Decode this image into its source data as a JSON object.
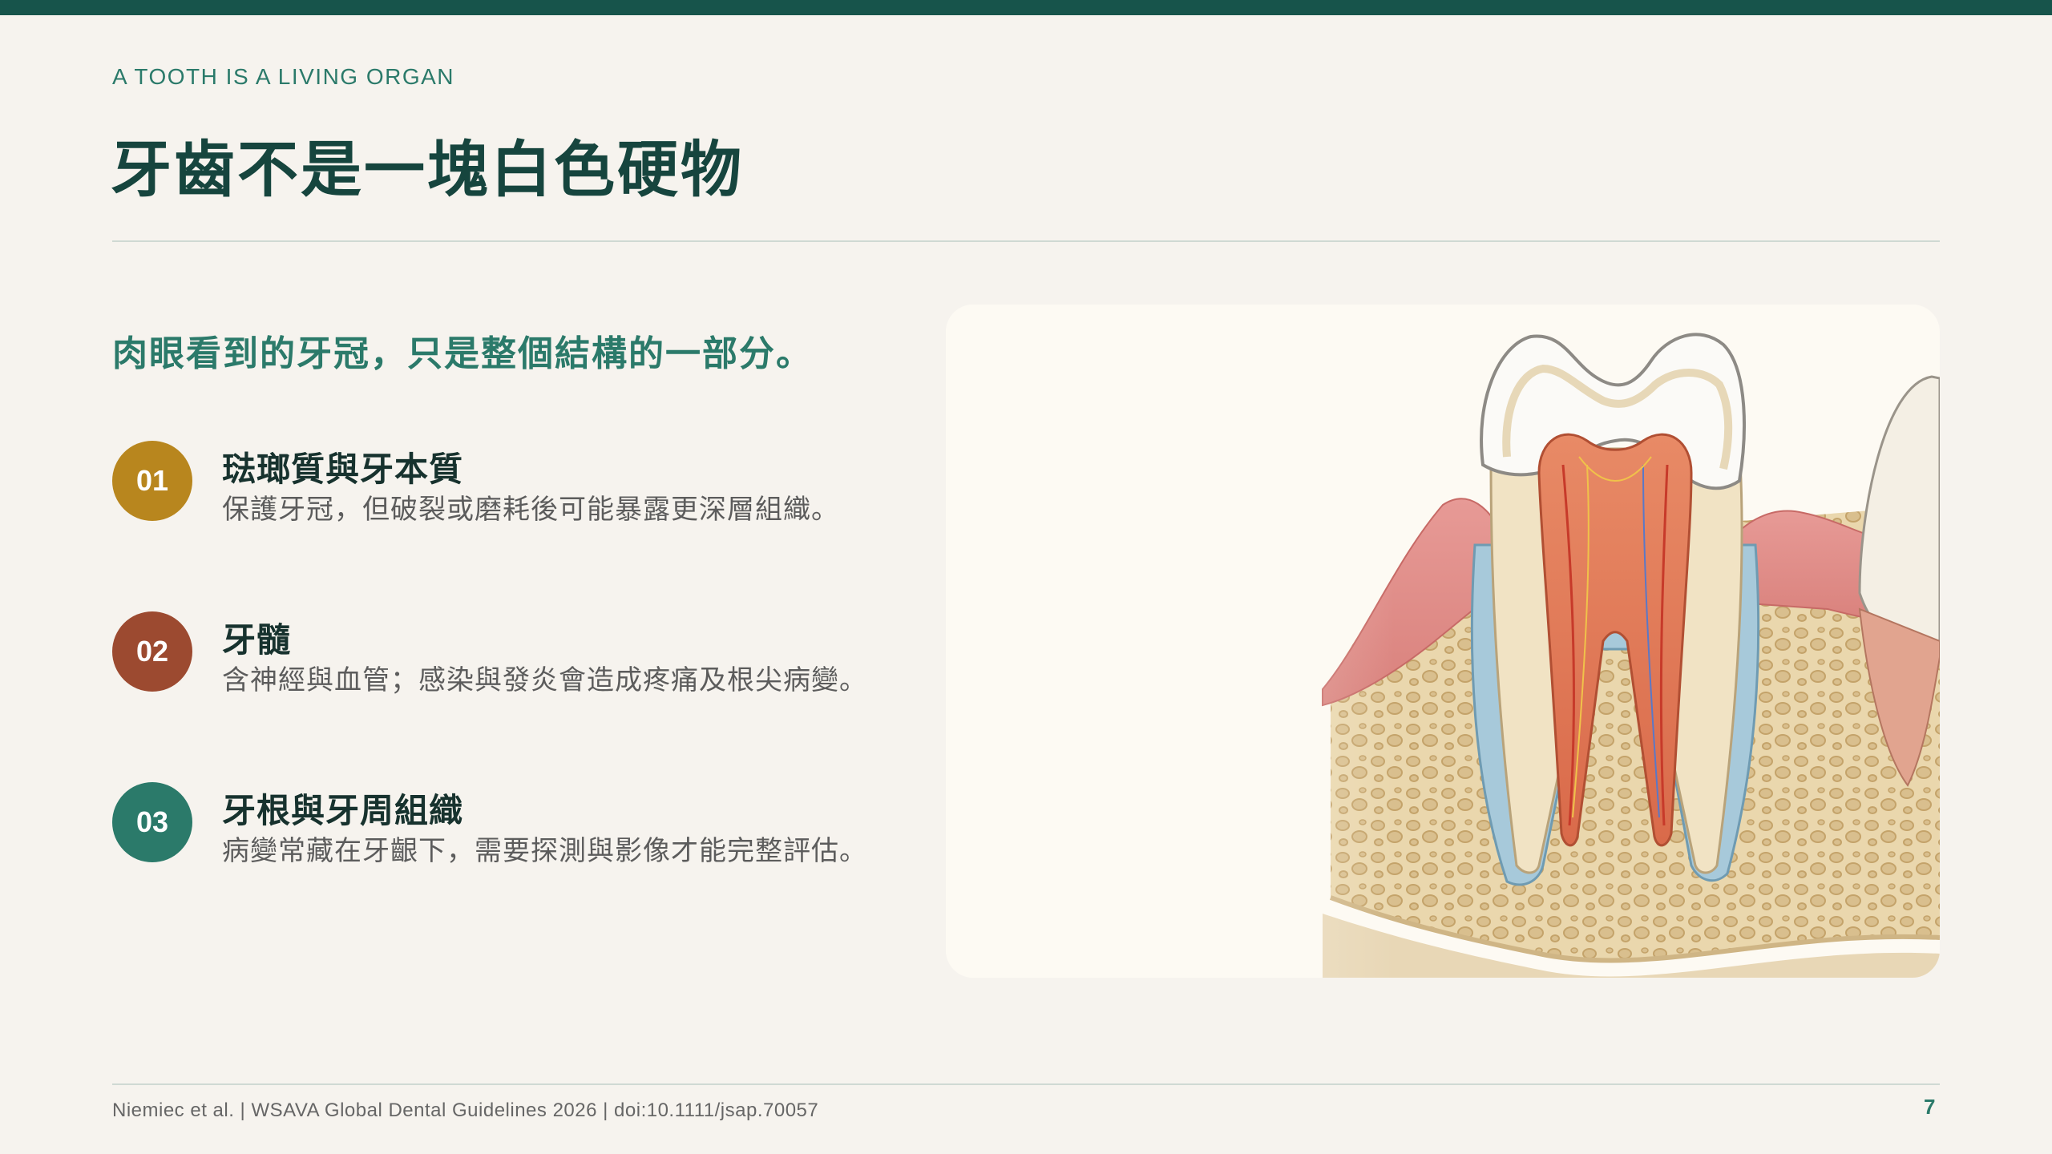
{
  "slide": {
    "eyebrow": "A TOOTH IS A LIVING ORGAN",
    "title": "牙齒不是一塊白色硬物",
    "lead": "肉眼看到的牙冠，只是整個結構的一部分。",
    "items": [
      {
        "number": "01",
        "title": "琺瑯質與牙本質",
        "desc": "保護牙冠，但破裂或磨耗後可能暴露更深層組織。",
        "color": "#b8861e"
      },
      {
        "number": "02",
        "title": "牙髓",
        "desc": "含神經與血管；感染與發炎會造成疼痛及根尖病變。",
        "color": "#9c4a30"
      },
      {
        "number": "03",
        "title": "牙根與牙周組織",
        "desc": "病變常藏在牙齦下，需要探測與影像才能完整評估。",
        "color": "#2b7a6a"
      }
    ],
    "illustration": {
      "icon": "tooth-cross-section-illustration"
    },
    "footer": {
      "citation": "Niemiec et al. | WSAVA Global Dental Guidelines 2026 | doi:10.1111/jsap.70057",
      "page_number": "7"
    }
  },
  "colors": {
    "accent": "#17544b",
    "heading": "#16453e",
    "teal": "#2b7a6a",
    "background": "#f6f3ee"
  }
}
